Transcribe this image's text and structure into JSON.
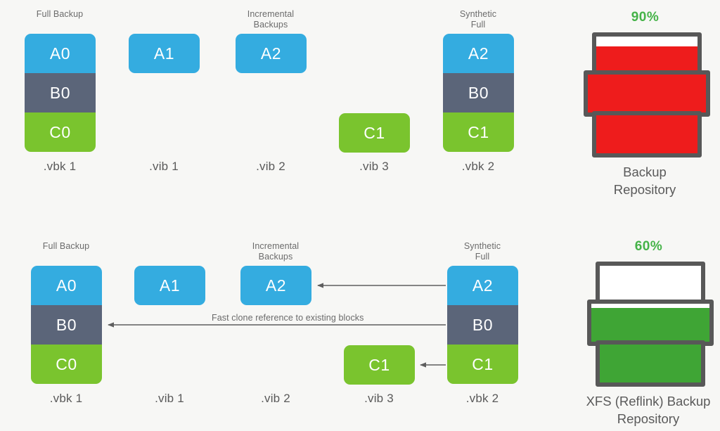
{
  "meta": {
    "background_color": "#f7f7f5",
    "accent_blue": "#34ace0",
    "accent_slate": "#5b6579",
    "accent_green": "#7ac42e",
    "pct_text_color": "#45b348",
    "repo_outline_color": "#585858",
    "repo_fill_red": "#ee1c1c",
    "repo_fill_green": "#3fa535"
  },
  "rows": [
    {
      "id": "row-standard",
      "columns": [
        {
          "caption": "Full Backup",
          "file_label": ".vbk 1",
          "blocks": [
            {
              "label": "A0",
              "kind": "a"
            },
            {
              "label": "B0",
              "kind": "b"
            },
            {
              "label": "C0",
              "kind": "c"
            }
          ]
        },
        {
          "caption": "",
          "file_label": ".vib 1",
          "blocks": [
            {
              "label": "A1",
              "kind": "a"
            }
          ]
        },
        {
          "caption": "Incremental\nBackups",
          "file_label": ".vib 2",
          "blocks": [
            {
              "label": "A2",
              "kind": "a"
            }
          ]
        },
        {
          "caption": "",
          "file_label": ".vib 3",
          "blocks": [
            {
              "label": "C1",
              "kind": "c"
            }
          ]
        },
        {
          "caption": "Synthetic\nFull",
          "file_label": ".vbk 2",
          "blocks": [
            {
              "label": "A2",
              "kind": "a"
            },
            {
              "label": "B0",
              "kind": "b"
            },
            {
              "label": "C1",
              "kind": "c"
            }
          ]
        }
      ],
      "repository": {
        "percent": "90%",
        "name": "Backup\nRepository",
        "fill_color": "#ee1c1c",
        "fill_level": 90
      },
      "arrows": []
    },
    {
      "id": "row-xfs-reflink",
      "columns": [
        {
          "caption": "Full Backup",
          "file_label": ".vbk 1",
          "blocks": [
            {
              "label": "A0",
              "kind": "a"
            },
            {
              "label": "B0",
              "kind": "b"
            },
            {
              "label": "C0",
              "kind": "c"
            }
          ]
        },
        {
          "caption": "",
          "file_label": ".vib 1",
          "blocks": [
            {
              "label": "A1",
              "kind": "a"
            }
          ]
        },
        {
          "caption": "Incremental\nBackups",
          "file_label": ".vib 2",
          "blocks": [
            {
              "label": "A2",
              "kind": "a"
            }
          ]
        },
        {
          "caption": "",
          "file_label": ".vib 3",
          "blocks": [
            {
              "label": "C1",
              "kind": "c"
            }
          ]
        },
        {
          "caption": "Synthetic\nFull",
          "file_label": ".vbk 2",
          "blocks": [
            {
              "label": "A2",
              "kind": "a"
            },
            {
              "label": "B0",
              "kind": "b"
            },
            {
              "label": "C1",
              "kind": "c"
            }
          ]
        }
      ],
      "repository": {
        "percent": "60%",
        "name": "XFS (Reflink) Backup\nRepository",
        "fill_color": "#3fa535",
        "fill_level": 60
      },
      "arrows": [
        {
          "name": "arrow-a2-to-a2",
          "label": ""
        },
        {
          "name": "arrow-b0-to-b0",
          "label": "Fast clone reference to existing blocks"
        },
        {
          "name": "arrow-c1-to-c1",
          "label": ""
        }
      ]
    }
  ]
}
